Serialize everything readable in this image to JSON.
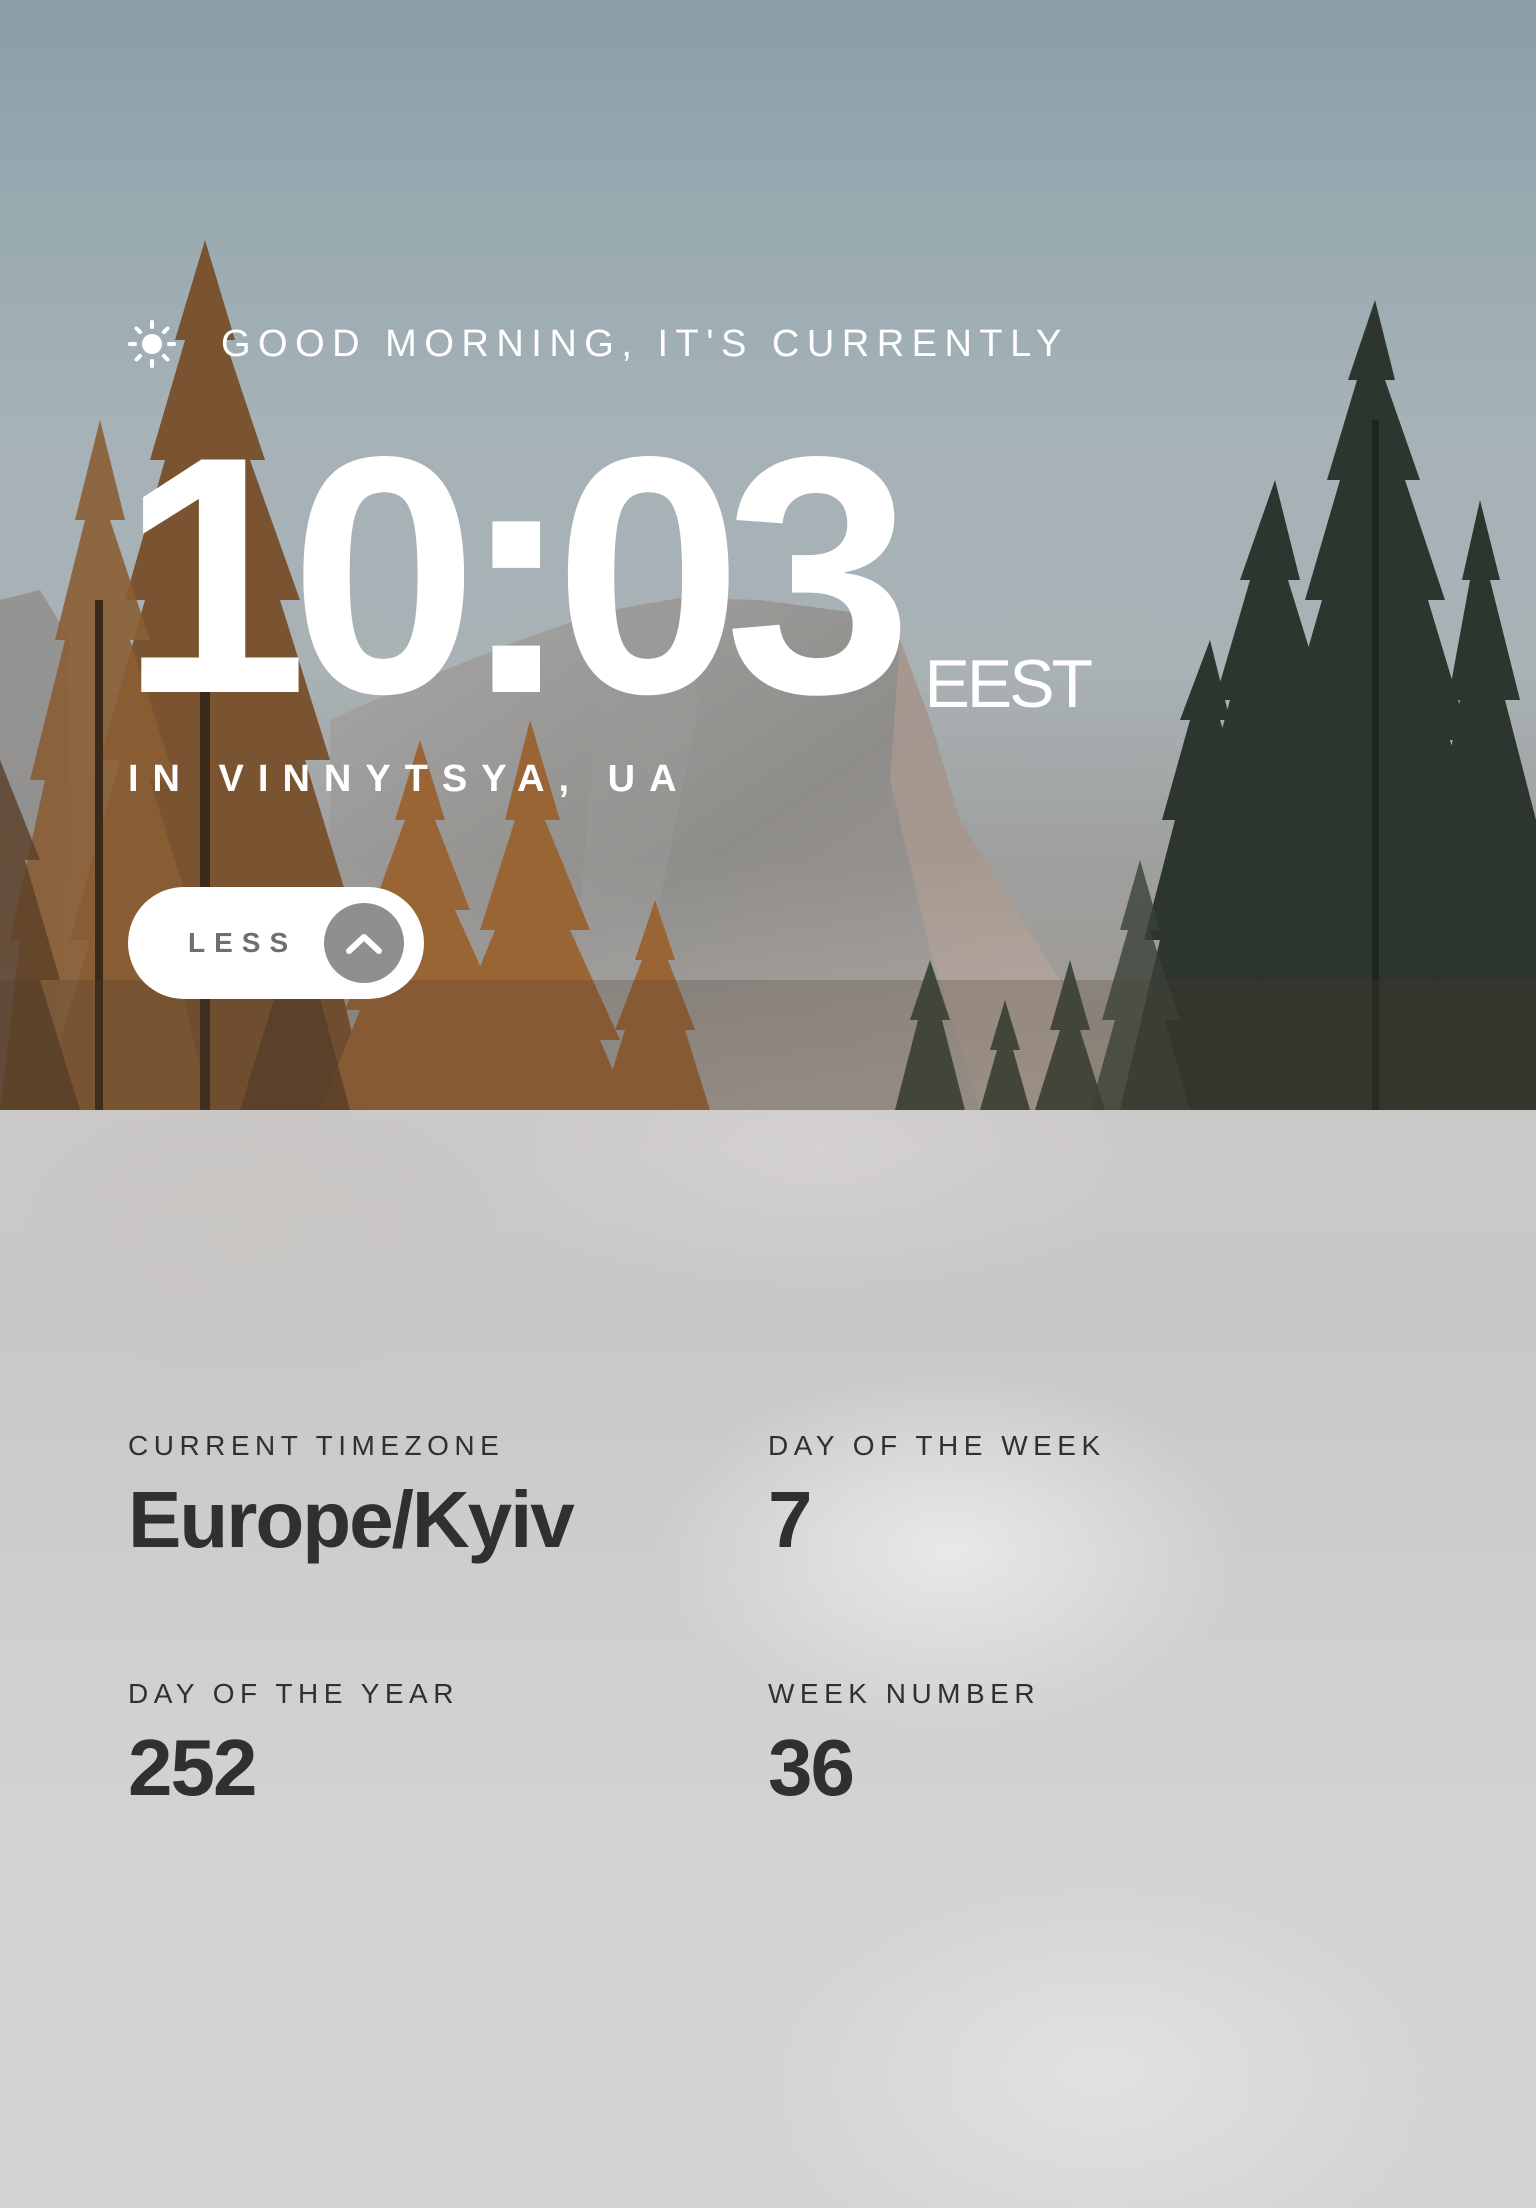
{
  "hero": {
    "greeting_icon": "sun-icon",
    "greeting": "GOOD MORNING, IT'S CURRENTLY",
    "time": "10:03",
    "timezone_abbr": "EEST",
    "location": "IN VINNYTSYA, UA"
  },
  "toggle": {
    "label": "LESS",
    "icon": "chevron-up-icon"
  },
  "details": {
    "timezone_label": "CURRENT TIMEZONE",
    "timezone_value": "Europe/Kyiv",
    "day_of_week_label": "DAY OF THE WEEK",
    "day_of_week_value": "7",
    "day_of_year_label": "DAY OF THE YEAR",
    "day_of_year_value": "252",
    "week_number_label": "WEEK NUMBER",
    "week_number_value": "36"
  },
  "colors": {
    "text_light": "#ffffff",
    "text_dark": "#303030",
    "button_bg": "#ffffff",
    "button_arrow_bg": "#8f8f8f",
    "panel_bg": "#cfd1d3"
  }
}
